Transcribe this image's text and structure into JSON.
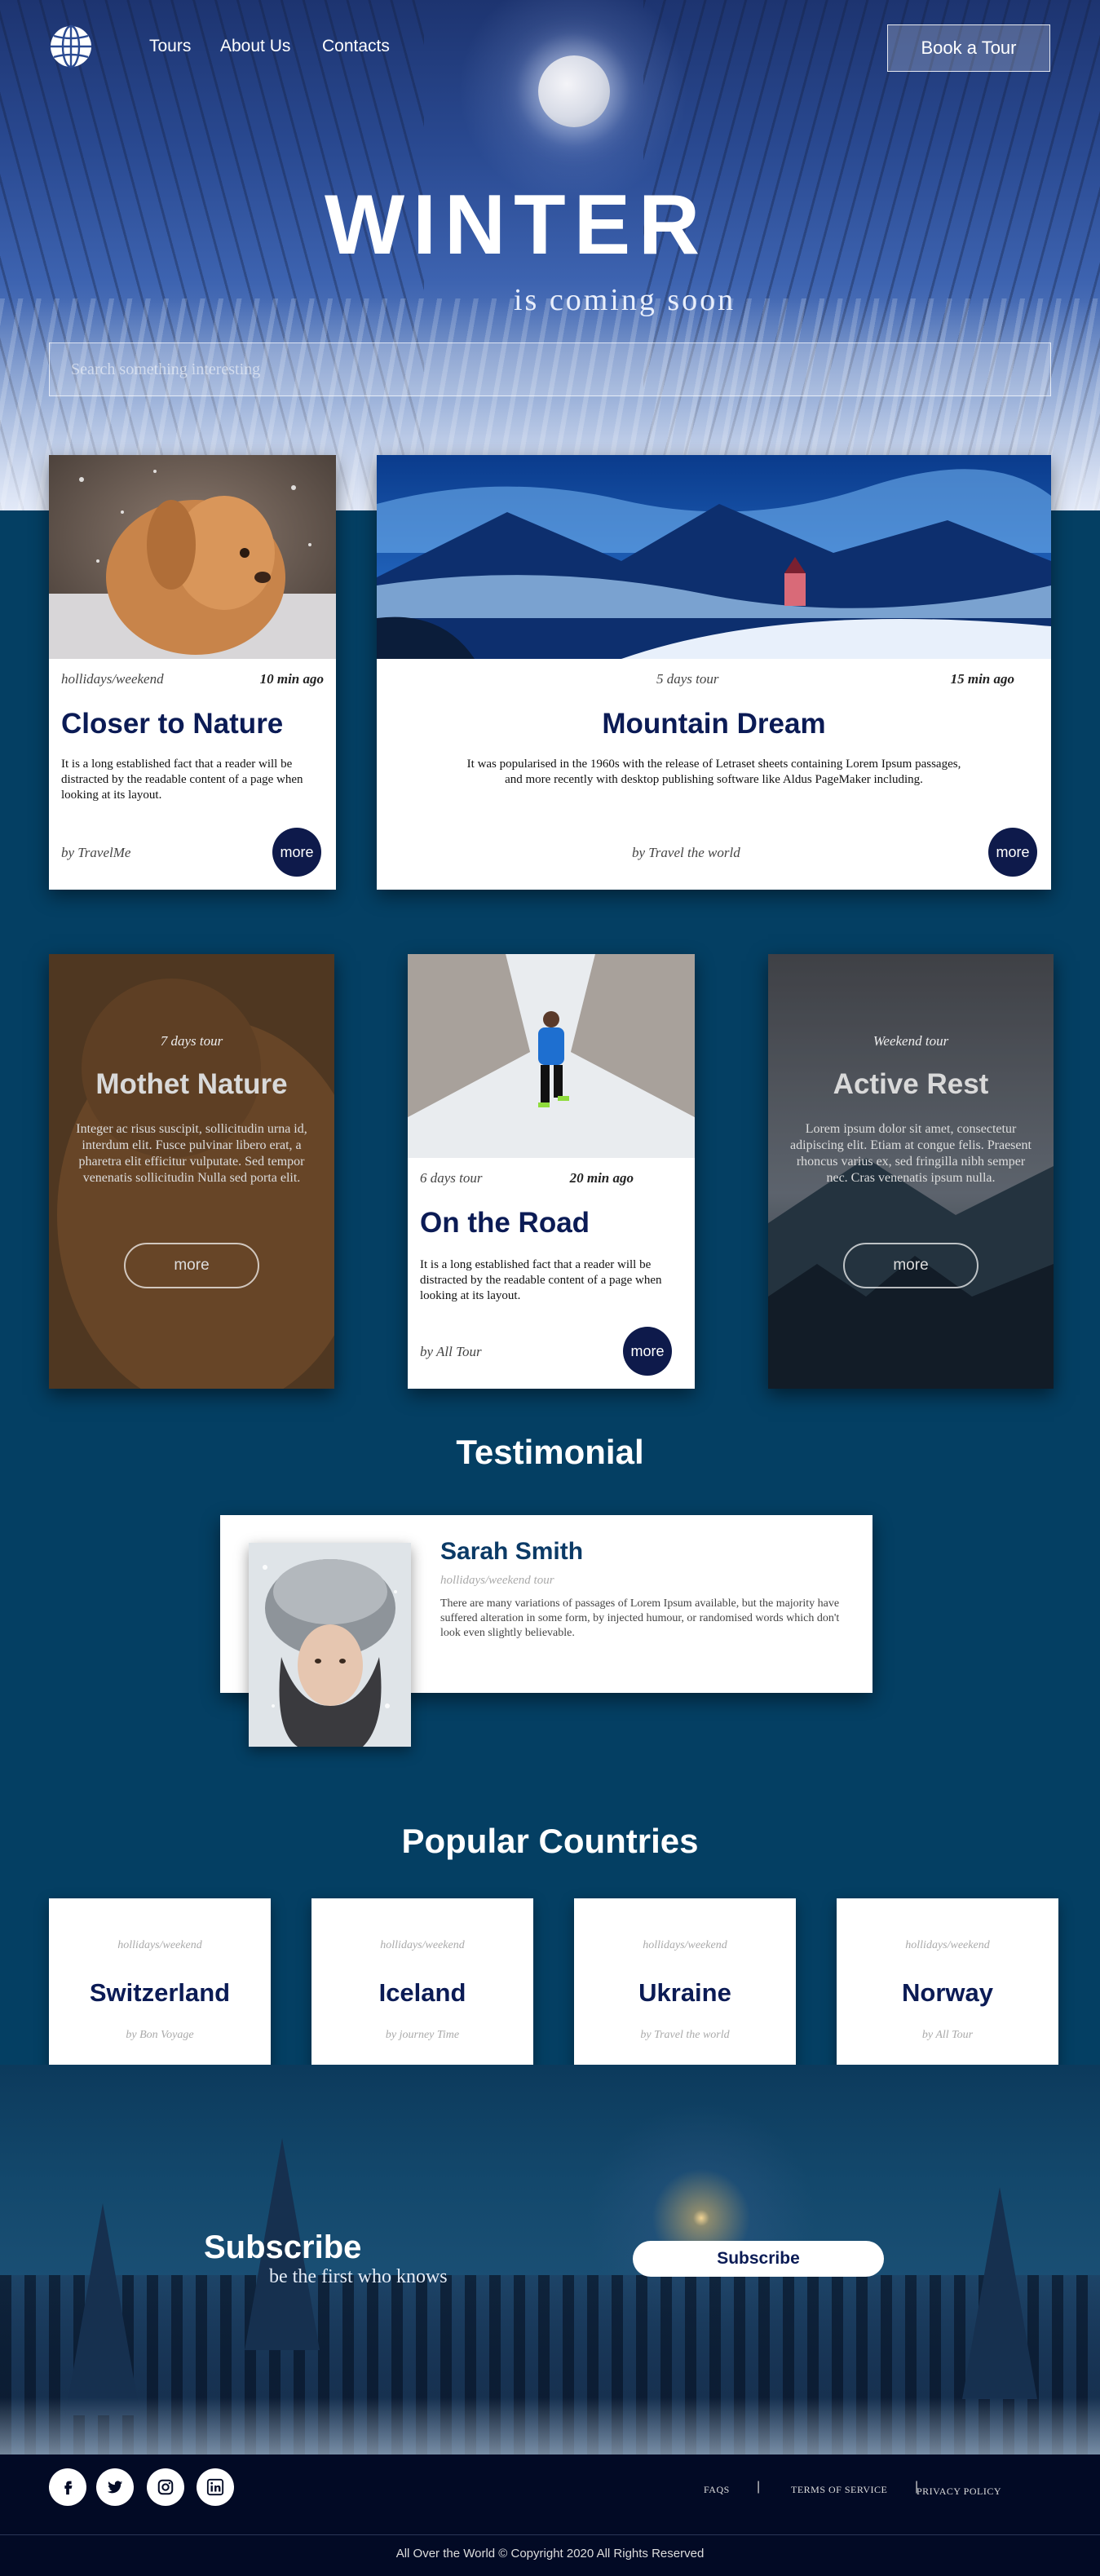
{
  "header": {
    "nav": [
      "Tours",
      "About Us",
      "Contacts"
    ],
    "book_label": "Book a Tour"
  },
  "hero": {
    "title": "WINTER",
    "subtitle": "is coming soon",
    "search_placeholder": "Search something interesting"
  },
  "featured": [
    {
      "category": "hollidays/weekend",
      "time": "10 min ago",
      "title": "Closer to Nature",
      "text": "It is a long established fact that a reader will be distracted by the readable content of a page when looking at its layout.",
      "by": "by TravelMe",
      "button": "more"
    },
    {
      "category": "5 days tour",
      "time": "15 min ago",
      "title": "Mountain Dream",
      "text": "It was popularised in the 1960s with the release of Letraset sheets containing Lorem Ipsum passages, and more recently with desktop publishing software like Aldus PageMaker including.",
      "by": "by Travel the world",
      "button": "more"
    }
  ],
  "tours": [
    {
      "category": "7 days tour",
      "title": "Mothet Nature",
      "text": "Integer ac risus suscipit, sollicitudin urna id, interdum elit. Fusce pulvinar libero erat, a pharetra elit efficitur vulputate. Sed tempor venenatis sollicitudin Nulla sed porta elit.",
      "button": "more"
    },
    {
      "category": "6 days tour",
      "time": "20 min ago",
      "title": "On the Road",
      "text": "It is a long established fact that a reader will be distracted by the readable content of a page when looking at its layout.",
      "by": "by All Tour",
      "button": "more"
    },
    {
      "category": "Weekend tour",
      "title": "Active Rest",
      "text": "Lorem ipsum dolor sit amet, consectetur adipiscing elit. Etiam at congue felis. Praesent rhoncus varius ex, sed fringilla nibh semper nec. Cras venenatis ipsum nulla.",
      "button": "more"
    }
  ],
  "testimonial": {
    "heading": "Testimonial",
    "name": "Sarah Smith",
    "category": "hollidays/weekend tour",
    "text": "There are many variations of passages of Lorem Ipsum available, but the majority have suffered alteration in some form, by injected humour, or randomised words which don't look even slightly believable."
  },
  "countries": {
    "heading": "Popular Countries",
    "items": [
      {
        "category": "hollidays/weekend",
        "name": "Switzerland",
        "by": "by Bon Voyage"
      },
      {
        "category": "hollidays/weekend",
        "name": "Iceland",
        "by": "by journey Time"
      },
      {
        "category": "hollidays/weekend",
        "name": "Ukraine",
        "by": "by Travel the world"
      },
      {
        "category": "hollidays/weekend",
        "name": "Norway",
        "by": "by All Tour"
      }
    ]
  },
  "subscribe": {
    "title": "Subscribe",
    "text": "be the first who knows",
    "button": "Subscribe"
  },
  "footer": {
    "social_icons": [
      "facebook-icon",
      "twitter-icon",
      "instagram-icon",
      "linkedin-icon"
    ],
    "links": [
      "FAQS",
      "TERMS OF SERVICE",
      "PRIVACY POLICY"
    ],
    "copyright": "All Over the World © Copyright 2020 All Rights Reserved"
  },
  "colors": {
    "page_bg": "#043f63",
    "accent": "#0e1a4b",
    "footer_bg": "#020a25"
  }
}
